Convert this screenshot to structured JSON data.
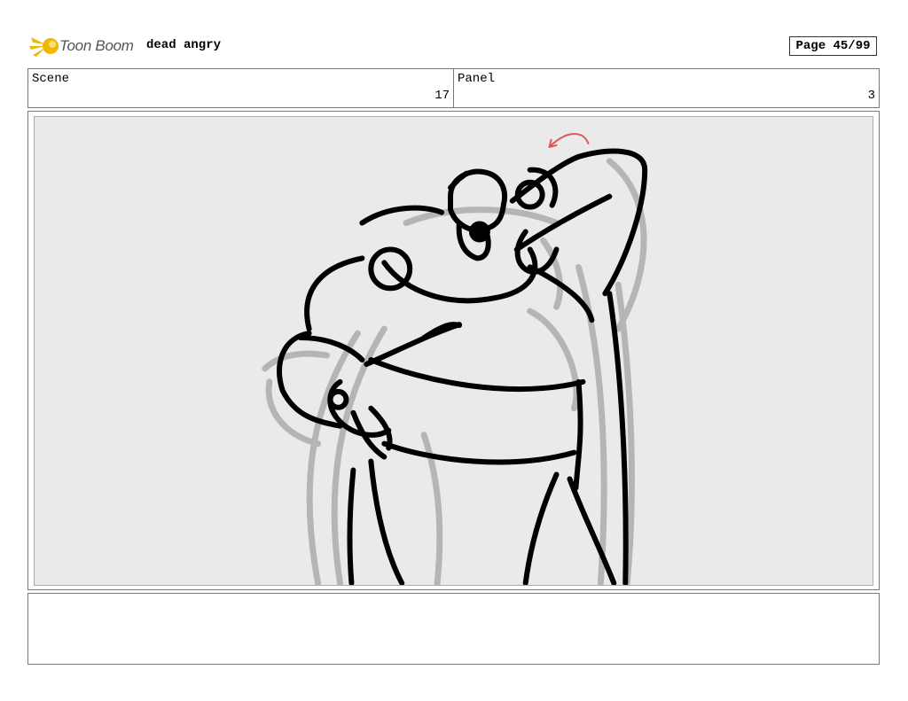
{
  "header": {
    "logo_text": "Toon Boom",
    "project_title": "dead angry",
    "page_indicator": "Page 45/99"
  },
  "info": {
    "scene_label": "Scene",
    "scene_value": "17",
    "panel_label": "Panel",
    "panel_value": "3"
  },
  "panel_image": {
    "description_icon": "sketch-drawing",
    "background_color": "#eaeaea",
    "ink_color": "#000000",
    "rough_color": "#b5b5b5",
    "arrow_color": "#e05555"
  },
  "notes": {
    "text": ""
  },
  "colors": {
    "logo_burst": "#f2b705",
    "border": "#777777"
  }
}
